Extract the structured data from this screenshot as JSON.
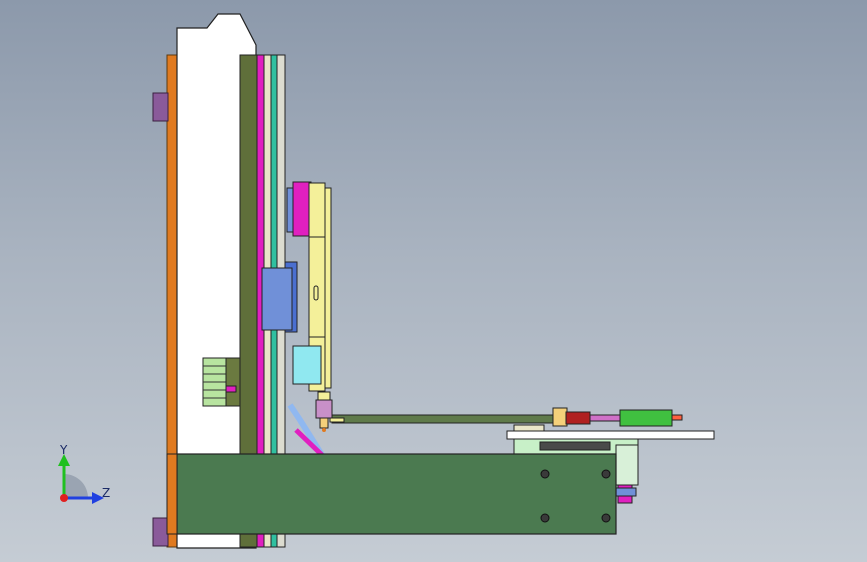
{
  "triad": {
    "y_label": "Y",
    "z_label": "Z"
  },
  "colors": {
    "background_top": "#8c99ab",
    "background_bottom": "#c5ccd4",
    "frame_white": "#ffffff",
    "orange_plate": "#e07a20",
    "olive_plate": "#5f6f3a",
    "magenta_plate": "#e020c0",
    "teal_plate": "#30c0a0",
    "base_green": "#4b7a50",
    "yellow_slide": "#f4f09a",
    "cylinder_blue": "#7090d8",
    "cyan_block": "#90e8f0",
    "purple_cap": "#8a5a9a",
    "axis_y": "#20c020",
    "axis_z": "#2040e0"
  }
}
